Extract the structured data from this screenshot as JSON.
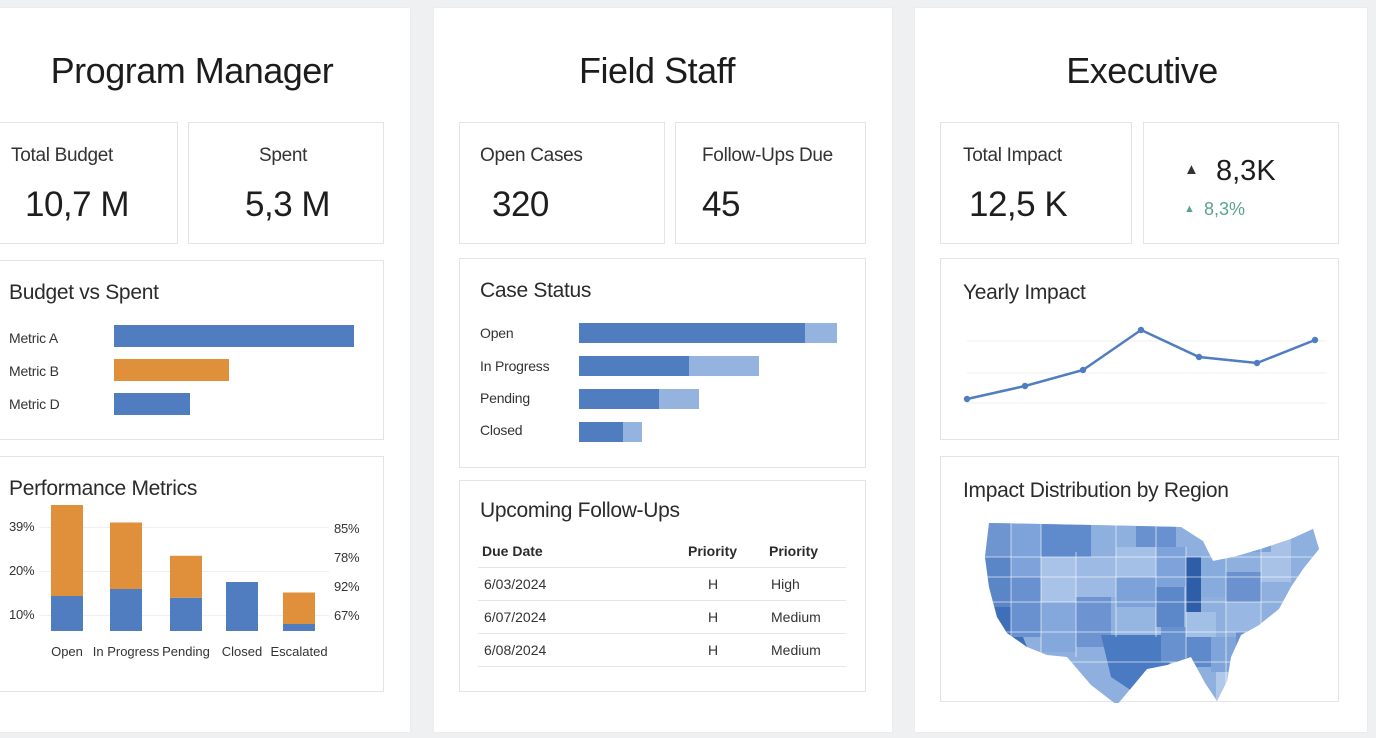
{
  "program_manager": {
    "title": "Program Manager",
    "kpis": [
      {
        "label": "Total Budget",
        "value": "10,7 M"
      },
      {
        "label": "Spent",
        "value": "5,3 M"
      }
    ],
    "budget_vs_spent": {
      "title": "Budget vs Spent",
      "rows": [
        {
          "label": "Metric A",
          "color": "#4f7dbf"
        },
        {
          "label": "Metric B",
          "color": "#e08f3b"
        },
        {
          "label": "Metric D",
          "color": "#4f7dbf"
        }
      ]
    },
    "performance": {
      "title": "Performance Metrics",
      "left_ticks": [
        "39%",
        "20%",
        "10%"
      ],
      "right_ticks": [
        "85%",
        "78%",
        "92%",
        "67%"
      ],
      "categories": [
        "Open",
        "In Progress",
        "Pending",
        "Closed",
        "Escalated"
      ]
    }
  },
  "field_staff": {
    "title": "Field Staff",
    "kpis": [
      {
        "label": "Open Cases",
        "value": "320"
      },
      {
        "label": "Follow-Ups Due",
        "value": "45"
      }
    ],
    "case_status": {
      "title": "Case Status",
      "rows": [
        {
          "label": "Open"
        },
        {
          "label": "In Progress"
        },
        {
          "label": "Pending"
        },
        {
          "label": "Closed"
        }
      ]
    },
    "followups": {
      "title": "Upcoming Follow-Ups",
      "headers": [
        "Due Date",
        "Priority",
        "Priority"
      ],
      "rows": [
        [
          "6/03/2024",
          "H",
          "High"
        ],
        [
          "6/07/2024",
          "H",
          "Medium"
        ],
        [
          "6/08/2024",
          "H",
          "Medium"
        ]
      ]
    }
  },
  "executive": {
    "title": "Executive",
    "total_impact": {
      "label": "Total Impact",
      "value": "12,5 K"
    },
    "delta": {
      "value": "8,3K",
      "percent": "8,3%",
      "arrow": "▲",
      "percent_color": "#5aa58a"
    },
    "yearly_impact_title": "Yearly Impact",
    "map_title": "Impact Distribution by Region"
  },
  "chart_data": [
    {
      "type": "bar",
      "title": "Budget vs Spent",
      "categories": [
        "Metric A",
        "Metric B",
        "Metric D"
      ],
      "values": [
        240,
        115,
        76
      ]
    },
    {
      "type": "bar",
      "title": "Performance Metrics",
      "categories": [
        "Open",
        "In Progress",
        "Pending",
        "Closed",
        "Escalated"
      ],
      "series": [
        {
          "values": [
            10,
            12,
            9.5,
            14,
            2
          ]
        },
        {
          "values": [
            26,
            19,
            12,
            0,
            9
          ]
        }
      ],
      "y_ticks_left": [
        "39%",
        "20%",
        "10%"
      ],
      "y_ticks_right": [
        "85%",
        "78%",
        "92%",
        "67%"
      ]
    },
    {
      "type": "bar",
      "title": "Case Status",
      "categories": [
        "Open",
        "In Progress",
        "Pending",
        "Closed"
      ],
      "series": [
        {
          "values": [
            226,
            110,
            80,
            44
          ]
        },
        {
          "values": [
            32,
            70,
            40,
            19
          ]
        }
      ]
    },
    {
      "type": "line",
      "title": "Yearly Impact",
      "x": [
        1,
        2,
        3,
        4,
        5,
        6,
        7
      ],
      "values": [
        30,
        43,
        59,
        99,
        72,
        66,
        89
      ],
      "ylim": [
        0,
        110
      ]
    }
  ]
}
